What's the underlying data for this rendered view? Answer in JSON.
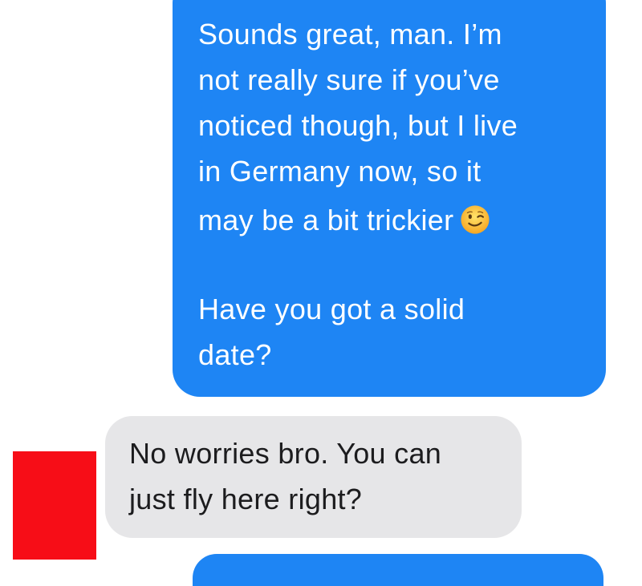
{
  "conversation": {
    "outgoing_message": {
      "lines": [
        "Sounds great, man. I’m",
        "not really sure if you’ve",
        "noticed though, but I live",
        "in Germany now, so it",
        "may be a bit trickier",
        "Have you got a solid",
        "date?"
      ],
      "emoji": "winking-face-emoji",
      "bubble_color": "#1e85f4"
    },
    "incoming_message": {
      "lines": [
        "No worries bro. You can",
        "just fly here right?"
      ],
      "bubble_color": "#e6e6e8"
    },
    "avatar": {
      "color": "#f70d17"
    }
  }
}
